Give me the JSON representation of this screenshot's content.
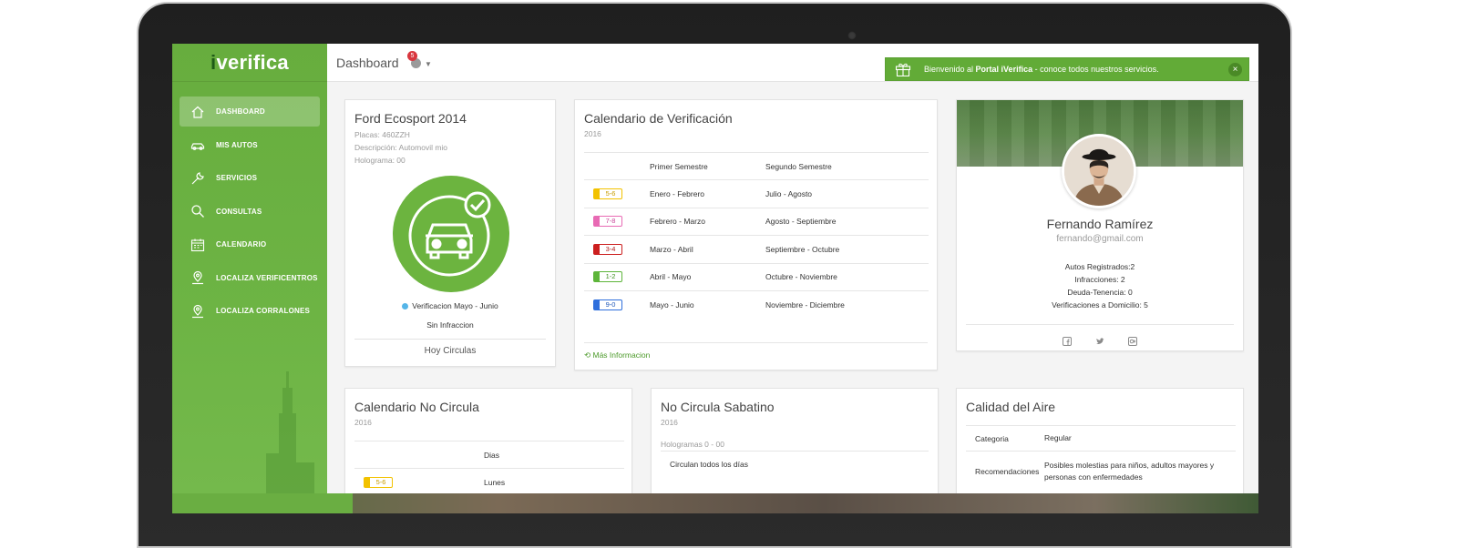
{
  "brand": {
    "prefix": "i",
    "name": "verifica"
  },
  "topbar": {
    "title": "Dashboard",
    "notif_count": "5",
    "welcome_pre": "Bienvenido al ",
    "welcome_bold": "Portal iVerifica",
    "welcome_post": " - conoce todos nuestros servicios.",
    "close": "×"
  },
  "sidebar": {
    "items": [
      {
        "label": "DASHBOARD",
        "icon": "home-icon",
        "active": true
      },
      {
        "label": "MIS AUTOS",
        "icon": "car-icon"
      },
      {
        "label": "SERVICIOS",
        "icon": "wrench-icon"
      },
      {
        "label": "CONSULTAS",
        "icon": "search-icon"
      },
      {
        "label": "CALENDARIO",
        "icon": "calendar-icon"
      },
      {
        "label": "LOCALIZA VERIFICENTROS",
        "icon": "map-pin-icon"
      },
      {
        "label": "LOCALIZA CORRALONES",
        "icon": "map-pin-icon"
      }
    ]
  },
  "car": {
    "title": "Ford Ecosport 2014",
    "placas": "Placas: 460ZZH",
    "descripcion": "Descripción: Automovil mio",
    "holograma": "Holograma: 00",
    "status": "Verificacion Mayo - Junio",
    "sin": "Sin Infraccion",
    "hoy": "Hoy Circulas"
  },
  "calendar": {
    "title": "Calendario de Verificación",
    "year": "2016",
    "headers": [
      "",
      "Primer Semestre",
      "Segundo Semestre"
    ],
    "rows": [
      {
        "tag": "5-6",
        "color": "#f2c200",
        "first": "Enero - Febrero",
        "second": "Julio - Agosto"
      },
      {
        "tag": "7-8",
        "color": "#e86ab4",
        "first": "Febrero - Marzo",
        "second": "Agosto - Septiembre"
      },
      {
        "tag": "3-4",
        "color": "#cc1f1f",
        "first": "Marzo - Abril",
        "second": "Septiembre - Octubre"
      },
      {
        "tag": "1-2",
        "color": "#5db53a",
        "first": "Abril - Mayo",
        "second": "Octubre - Noviembre"
      },
      {
        "tag": "9-0",
        "color": "#2f6fdc",
        "first": "Mayo - Junio",
        "second": "Noviembre - Diciembre"
      }
    ],
    "more": "Más Informacion"
  },
  "profile": {
    "name": "Fernando Ramírez",
    "email": "fernando@gmail.com",
    "stats": [
      "Autos Registrados:2",
      "Infracciones: 2",
      "Deuda-Tenencia: 0",
      "Verificaciones a Domicilio: 5"
    ]
  },
  "no_circula": {
    "title": "Calendario No Circula",
    "year": "2016",
    "header": "Dias",
    "rows": [
      {
        "tag": "5-6",
        "color": "#f2c200",
        "day": "Lunes"
      }
    ]
  },
  "sabatino": {
    "title": "No Circula Sabatino",
    "year": "2016",
    "hologramas": "Hologramas 0 - 00",
    "text": "Circulan todos los días"
  },
  "aire": {
    "title": "Calidad del Aire",
    "rows": [
      {
        "label": "Categoria",
        "value": "Regular"
      },
      {
        "label": "Recomendaciones",
        "value": "Posibles molestias para niños, adultos mayores y personas con enfermedades"
      }
    ]
  }
}
